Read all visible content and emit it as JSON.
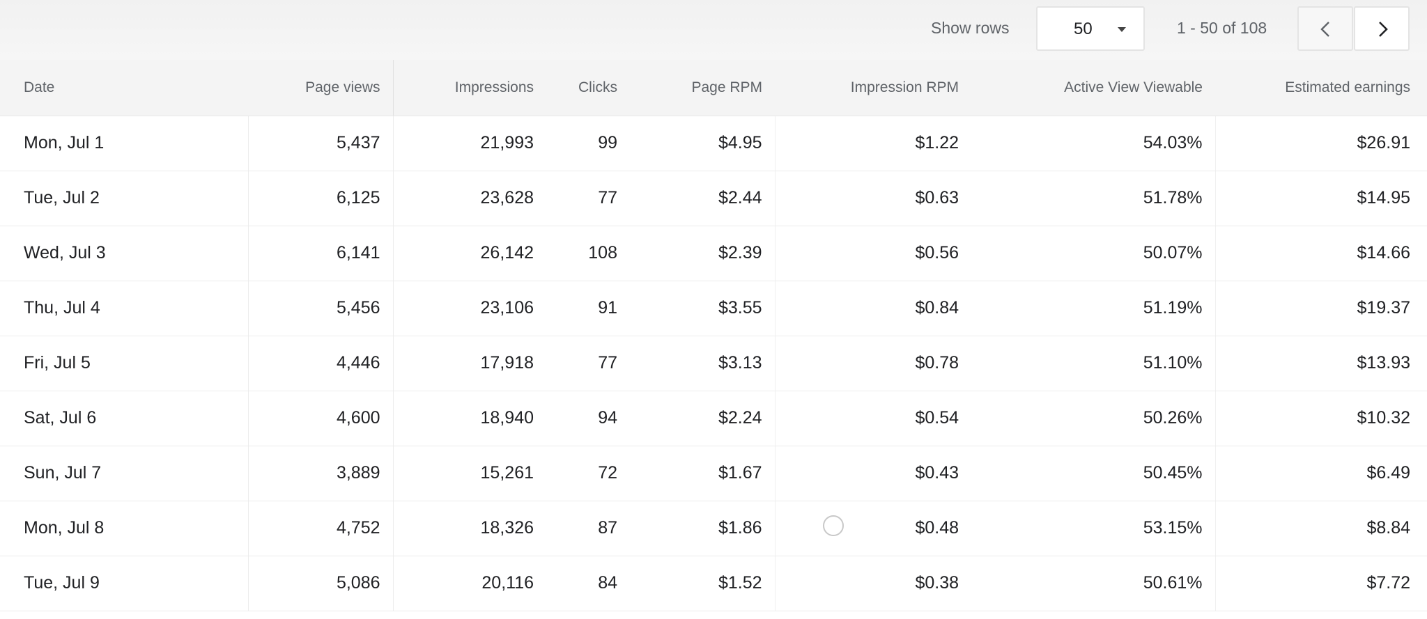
{
  "toolbar": {
    "show_rows_label": "Show rows",
    "rows_per_page": "50",
    "range": "1 - 50 of 108",
    "prev_icon": "chevron-left-icon",
    "next_icon": "chevron-right-icon"
  },
  "table": {
    "columns": [
      "Date",
      "Page views",
      "Impressions",
      "Clicks",
      "Page RPM",
      "Impression RPM",
      "Active View Viewable",
      "Estimated earnings"
    ],
    "rows": [
      [
        "Mon, Jul 1",
        "5,437",
        "21,993",
        "99",
        "$4.95",
        "$1.22",
        "54.03%",
        "$26.91"
      ],
      [
        "Tue, Jul 2",
        "6,125",
        "23,628",
        "77",
        "$2.44",
        "$0.63",
        "51.78%",
        "$14.95"
      ],
      [
        "Wed, Jul 3",
        "6,141",
        "26,142",
        "108",
        "$2.39",
        "$0.56",
        "50.07%",
        "$14.66"
      ],
      [
        "Thu, Jul 4",
        "5,456",
        "23,106",
        "91",
        "$3.55",
        "$0.84",
        "51.19%",
        "$19.37"
      ],
      [
        "Fri, Jul 5",
        "4,446",
        "17,918",
        "77",
        "$3.13",
        "$0.78",
        "51.10%",
        "$13.93"
      ],
      [
        "Sat, Jul 6",
        "4,600",
        "18,940",
        "94",
        "$2.24",
        "$0.54",
        "50.26%",
        "$10.32"
      ],
      [
        "Sun, Jul 7",
        "3,889",
        "15,261",
        "72",
        "$1.67",
        "$0.43",
        "50.45%",
        "$6.49"
      ],
      [
        "Mon, Jul 8",
        "4,752",
        "18,326",
        "87",
        "$1.86",
        "$0.48",
        "53.15%",
        "$8.84"
      ],
      [
        "Tue, Jul 9",
        "5,086",
        "20,116",
        "84",
        "$1.52",
        "$0.38",
        "50.61%",
        "$7.72"
      ]
    ]
  }
}
